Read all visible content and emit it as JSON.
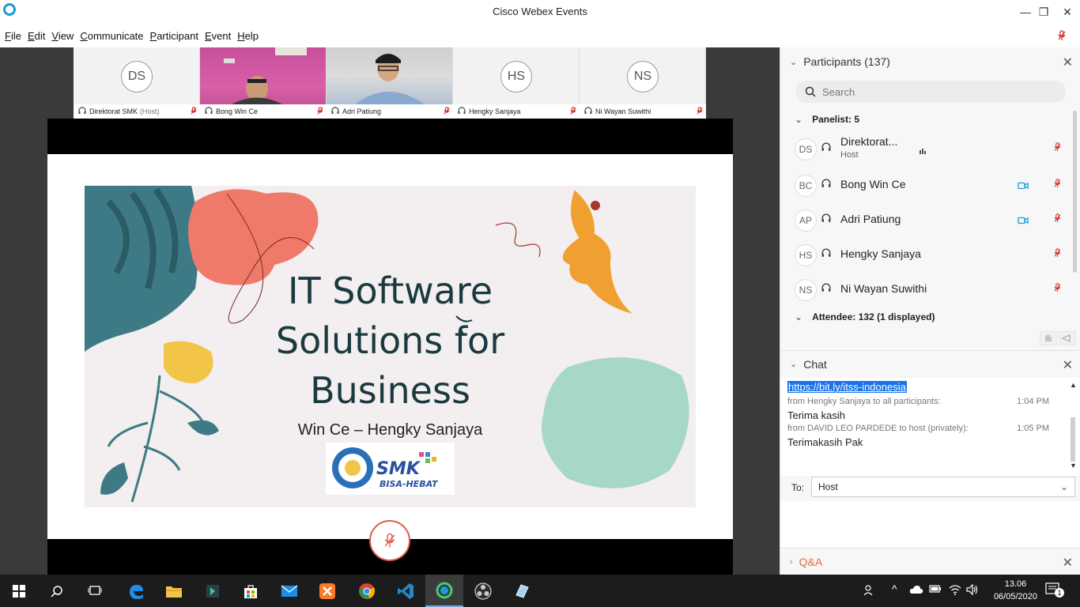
{
  "window": {
    "title": "Cisco Webex Events",
    "controls": {
      "minimize": "—",
      "restore": "❐",
      "close": "✕"
    }
  },
  "menu": [
    "File",
    "Edit",
    "View",
    "Communicate",
    "Participant",
    "Event",
    "Help"
  ],
  "thumbnails": [
    {
      "initials": "DS",
      "name": "Direktorat SMK",
      "tag": "(Host)",
      "video": false
    },
    {
      "initials": "",
      "name": "Bong Win Ce",
      "tag": "",
      "video": true
    },
    {
      "initials": "",
      "name": "Adri Patiung",
      "tag": "",
      "video": true
    },
    {
      "initials": "HS",
      "name": "Hengky Sanjaya",
      "tag": "",
      "video": false
    },
    {
      "initials": "NS",
      "name": "Ni Wayan Suwithi",
      "tag": "",
      "video": false
    }
  ],
  "slide": {
    "title_lines": [
      "IT Software",
      "Solutions for",
      "Business"
    ],
    "subtitle": "Win Ce – Hengky Sanjaya",
    "logo_text": [
      "SMK",
      "BISA-HEBAT"
    ]
  },
  "participants_panel": {
    "header": "Participants (137)",
    "search_placeholder": "Search",
    "panelist_header": "Panelist: 5",
    "attendee_header": "Attendee: 132 (1 displayed)",
    "panelists": [
      {
        "initials": "DS",
        "name": "Direktorat...",
        "role": "Host",
        "video": false
      },
      {
        "initials": "BC",
        "name": "Bong Win Ce",
        "role": "",
        "video": true
      },
      {
        "initials": "AP",
        "name": "Adri Patiung",
        "role": "",
        "video": true
      },
      {
        "initials": "HS",
        "name": "Hengky Sanjaya",
        "role": "",
        "video": false
      },
      {
        "initials": "NS",
        "name": "Ni Wayan Suwithi",
        "role": "",
        "video": false
      }
    ]
  },
  "chat_panel": {
    "header": "Chat",
    "messages": [
      {
        "text": "https://bit.ly/itss-indonesia",
        "is_link": true
      },
      {
        "meta": "from Hengky Sanjaya to all participants:",
        "time": "1:04 PM",
        "text": "Terima kasih"
      },
      {
        "meta": "from DAVID LEO PARDEDE to host (privately):",
        "time": "1:05 PM",
        "text": "Terimakasih Pak"
      }
    ],
    "to_label": "To:",
    "to_value": "Host"
  },
  "qa_panel": {
    "header": "Q&A"
  },
  "taskbar": {
    "time": "13.06",
    "date": "06/05/2020",
    "notification_count": "1"
  },
  "colors": {
    "accent": "#1e9bd7",
    "mute_red": "#e05a4a",
    "video_blue": "#1a9bd7",
    "link_bg": "#1a73e8",
    "slide_teal": "#1a3a3f"
  }
}
